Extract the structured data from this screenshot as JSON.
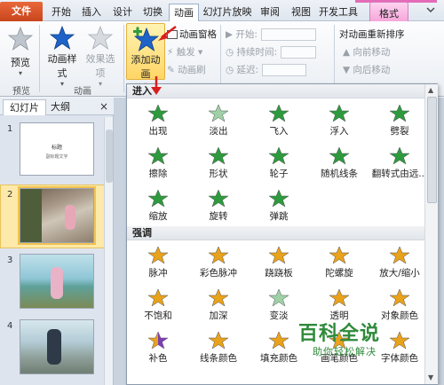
{
  "tabs": {
    "file": "文件",
    "items": [
      "开始",
      "插入",
      "设计",
      "切换",
      "动画",
      "幻灯片放映",
      "审阅",
      "视图",
      "开发工具"
    ],
    "format": "格式"
  },
  "ribbon": {
    "preview": {
      "button": "预览",
      "group": "预览"
    },
    "animation": {
      "style": "动画样式",
      "effect": "效果选项",
      "group": "动画"
    },
    "advanced": {
      "add": "添加动画",
      "pane": "动画窗格",
      "trigger": "触发",
      "painter": "动画刷"
    },
    "timing": {
      "start": "开始:",
      "duration": "持续时间:",
      "delay": "延迟:"
    },
    "reorder": {
      "title": "对动画重新排序",
      "forward": "向前移动",
      "backward": "向后移动"
    }
  },
  "pane": {
    "tab_slides": "幻灯片",
    "tab_outline": "大纲",
    "close": "×",
    "slides": [
      {
        "num": "1",
        "title": "标题",
        "sub": "副标题文字"
      },
      {
        "num": "2"
      },
      {
        "num": "3"
      },
      {
        "num": "4"
      }
    ]
  },
  "gallery": {
    "entrance": {
      "header": "进入",
      "items": [
        "出现",
        "淡出",
        "飞入",
        "浮入",
        "劈裂",
        "擦除",
        "形状",
        "轮子",
        "随机线条",
        "翻转式由远...",
        "缩放",
        "旋转",
        "弹跳"
      ]
    },
    "emphasis": {
      "header": "强调",
      "items": [
        "脉冲",
        "彩色脉冲",
        "跷跷板",
        "陀螺旋",
        "放大/缩小",
        "不饱和",
        "加深",
        "变淡",
        "透明",
        "对象颜色",
        "补色",
        "线条颜色",
        "填充颜色",
        "画笔颜色",
        "字体颜色"
      ]
    }
  },
  "watermark": {
    "title": "百科全说",
    "sub": "助你轻松解决"
  },
  "colors": {
    "file_tab": "#d2532a",
    "format_tab": "#f5a7da",
    "green_star": "#2e9a3e",
    "gold_star": "#e9a21b",
    "blue_star": "#1f63c9",
    "watermark": "#2f8a3b",
    "selection": "#fde9a9"
  }
}
